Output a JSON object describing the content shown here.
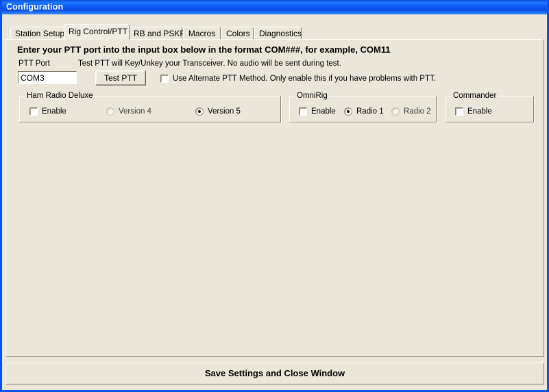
{
  "window": {
    "title": "Configuration",
    "border_color": "#0A52E8",
    "titlebar_color": "#0B5BF5",
    "face_color": "#EAE7DA"
  },
  "tabs": [
    {
      "label": "Station Setup",
      "active": false
    },
    {
      "label": "Rig Control/PTT",
      "active": true
    },
    {
      "label": "RB and PSKR",
      "active": false
    },
    {
      "label": "Macros",
      "active": false
    },
    {
      "label": "Colors",
      "active": false
    },
    {
      "label": "Diagnostics",
      "active": false
    }
  ],
  "panel": {
    "heading": "Enter your PTT port into the input box below in the format COM###, for example, COM11",
    "ptt_port_label": "PTT Port",
    "test_hint": "Test PTT will Key/Unkey your Transceiver.  No audio will be sent during test.",
    "ptt_port_value": "COM3",
    "ptt_port_placeholder": "COM###",
    "test_button_label": "Test PTT",
    "alternate_ptt": {
      "label": "Use Alternate PTT Method.  Only enable this if you have problems with PTT.",
      "checked": false
    }
  },
  "groups": {
    "ham_radio_deluxe": {
      "title": "Ham Radio Deluxe",
      "enable_label": "Enable",
      "enable_checked": false,
      "version_options": [
        {
          "label": "Version 4",
          "selected": false
        },
        {
          "label": "Version 5",
          "selected": true
        }
      ]
    },
    "omnirig": {
      "title": "OmniRig",
      "enable_label": "Enable",
      "enable_checked": false,
      "radio_options": [
        {
          "label": "Radio 1",
          "selected": true
        },
        {
          "label": "Radio 2",
          "selected": false
        }
      ]
    },
    "commander": {
      "title": "Commander",
      "enable_label": "Enable",
      "enable_checked": false
    }
  },
  "footer": {
    "save_label": "Save Settings and Close Window"
  }
}
